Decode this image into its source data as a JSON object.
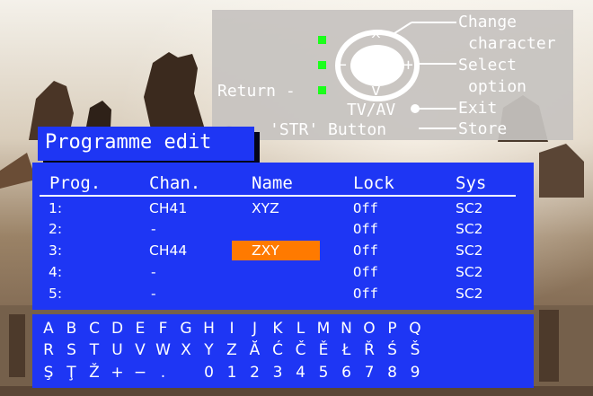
{
  "remote": {
    "labels": {
      "change_1": "Change",
      "change_2": "character",
      "select_1": "Select",
      "select_2": "option",
      "exit": "Exit",
      "store": "Store",
      "return": "Return -",
      "tv_av": "TV/AV",
      "str_button": "'STR' Button"
    },
    "pad_symbols": {
      "up": "^",
      "down": "v",
      "minus": "−",
      "plus": "+"
    },
    "colors": {
      "panel": "#c6c3c0",
      "indicator": "#1bff1b"
    }
  },
  "title": "Programme edit",
  "table": {
    "headers": [
      "Prog.",
      "Chan.",
      "Name",
      "Lock",
      "Sys"
    ],
    "rows": [
      {
        "prog": "1:",
        "chan": "CH41",
        "name": "XYZ",
        "lock": "Off",
        "sys": "SC2"
      },
      {
        "prog": "2:",
        "chan": "-",
        "name": "",
        "lock": "Off",
        "sys": "SC2"
      },
      {
        "prog": "3:",
        "chan": "CH44",
        "name": "ZXY",
        "lock": "Off",
        "sys": "SC2"
      },
      {
        "prog": "4:",
        "chan": "-",
        "name": "",
        "lock": "Off",
        "sys": "SC2"
      },
      {
        "prog": "5:",
        "chan": "-",
        "name": "",
        "lock": "Off",
        "sys": "SC2"
      }
    ],
    "selected_row": 3,
    "highlight_color": "#ff7a00"
  },
  "charset": {
    "row1": [
      "A",
      "B",
      "C",
      "D",
      "E",
      "F",
      "G",
      "H",
      "I",
      "J",
      "K",
      "L",
      "M",
      "N",
      "O",
      "P",
      "Q"
    ],
    "row2": [
      "R",
      "S",
      "T",
      "U",
      "V",
      "W",
      "X",
      "Y",
      "Z",
      "Ă",
      "Ć",
      "Č",
      "Ě",
      "Ł",
      "Ř",
      "Ś",
      "Š"
    ],
    "row3": [
      "Ş",
      "Ţ",
      "Ž",
      "+",
      "−",
      ".",
      "",
      "0",
      "1",
      "2",
      "3",
      "4",
      "5",
      "6",
      "7",
      "8",
      "9"
    ]
  },
  "colors": {
    "menu_blue": "#1e36f4",
    "text": "#ffffff"
  }
}
